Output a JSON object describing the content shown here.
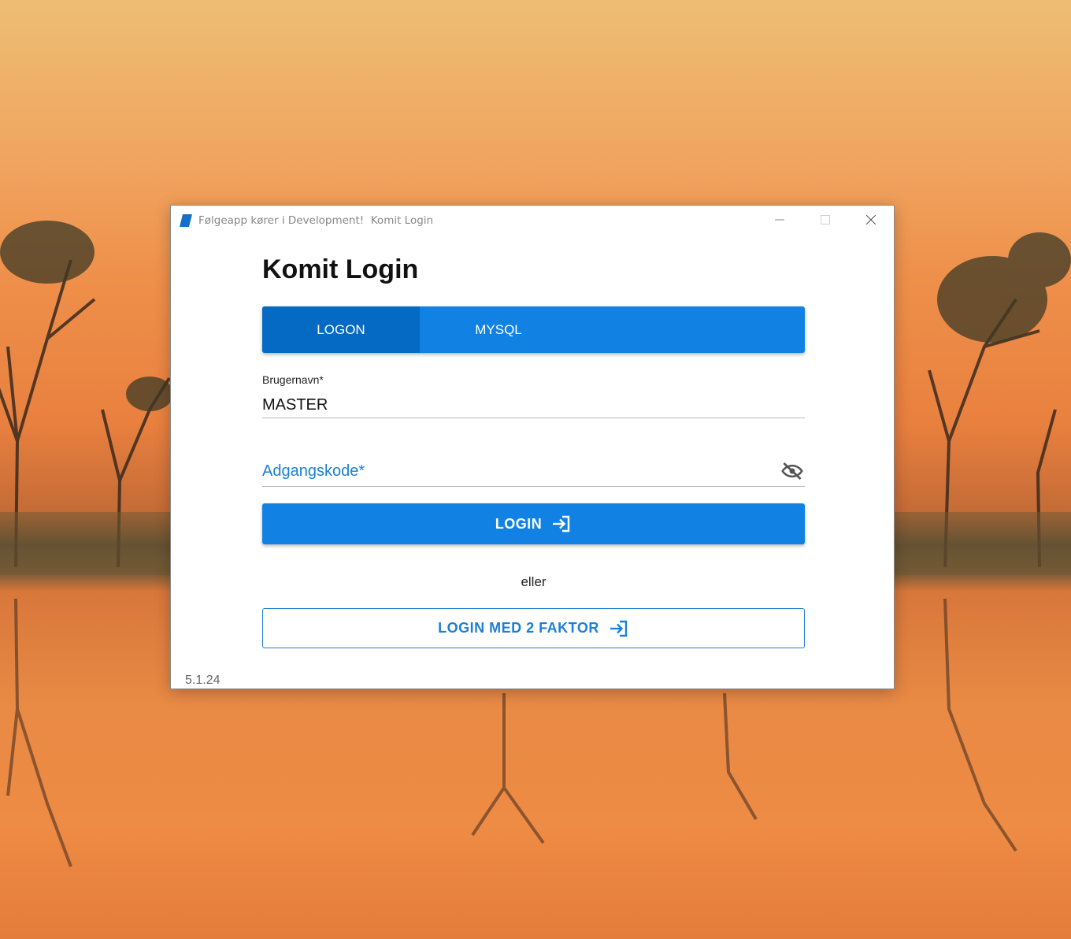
{
  "window": {
    "title": "Følgeapp kører i Development!  Komit Login"
  },
  "login": {
    "heading": "Komit Login",
    "tabs": [
      {
        "label": "LOGON",
        "active": true
      },
      {
        "label": "MYSQL",
        "active": false
      }
    ],
    "username": {
      "label": "Brugernavn*",
      "value": "MASTER"
    },
    "password": {
      "label": "Adgangskode*",
      "visibility_icon": "eye-off-icon"
    },
    "login_button": "LOGIN",
    "or_text": "eller",
    "twofactor_button": "LOGIN MED 2 FAKTOR",
    "version": "5.1.24"
  },
  "colors": {
    "primary": "#1182e4",
    "tab_active": "#056ac4",
    "accent_text": "#1d7fd6"
  }
}
